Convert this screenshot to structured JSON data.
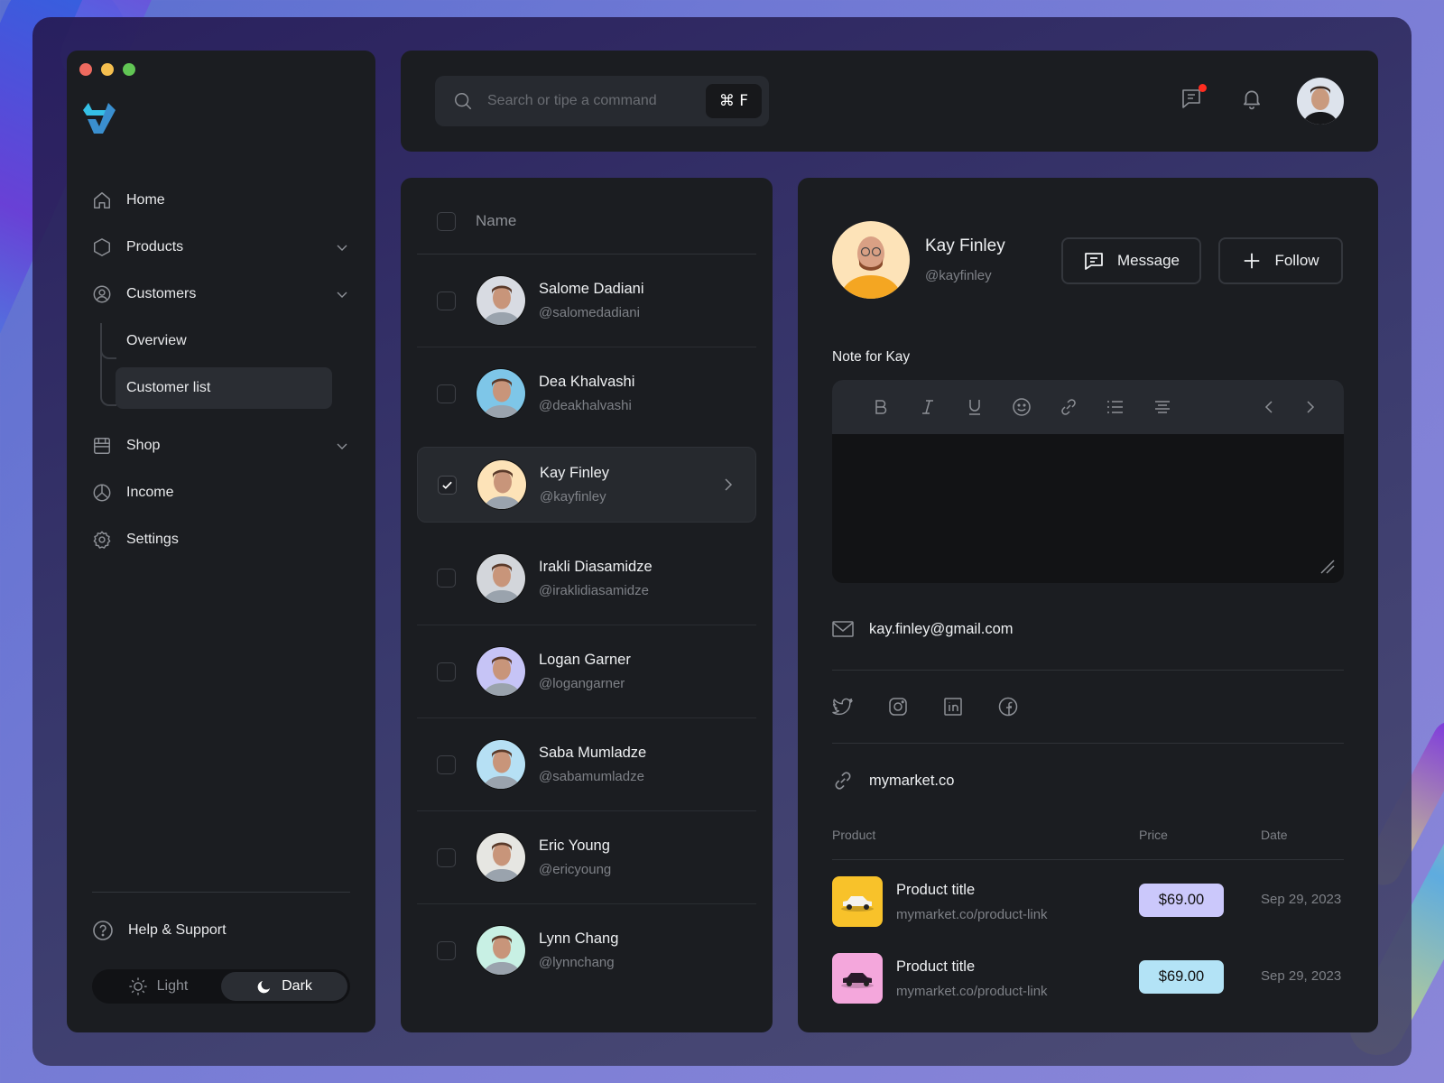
{
  "window": {
    "traffic_lights": [
      "close",
      "minimize",
      "maximize"
    ]
  },
  "sidebar": {
    "logo": "app-logo",
    "items": [
      {
        "label": "Home",
        "icon": "home-icon",
        "has_chevron": false
      },
      {
        "label": "Products",
        "icon": "hexagon-icon",
        "has_chevron": true
      },
      {
        "label": "Customers",
        "icon": "user-circle-icon",
        "has_chevron": true,
        "expanded": true,
        "children": [
          {
            "label": "Overview",
            "active": false
          },
          {
            "label": "Customer list",
            "active": true
          }
        ]
      },
      {
        "label": "Shop",
        "icon": "store-icon",
        "has_chevron": true
      },
      {
        "label": "Income",
        "icon": "pie-chart-icon",
        "has_chevron": false
      },
      {
        "label": "Settings",
        "icon": "gear-icon",
        "has_chevron": false
      }
    ],
    "help_label": "Help & Support",
    "theme": {
      "options": [
        "Light",
        "Dark"
      ],
      "selected": "Dark"
    }
  },
  "topbar": {
    "search": {
      "placeholder": "Search or tipe a command",
      "value": "",
      "shortcut": "⌘ F"
    },
    "icons": [
      "messages-icon",
      "bell-icon"
    ],
    "messages_has_badge": true,
    "badge_color": "#ff2d20"
  },
  "customer_list": {
    "header": "Name",
    "rows": [
      {
        "name": "Salome Dadiani",
        "handle": "@salomedadiani",
        "checked": false,
        "selected": false,
        "avatar_bg": "#d8dbe2"
      },
      {
        "name": "Dea Khalvashi",
        "handle": "@deakhalvashi",
        "checked": false,
        "selected": false,
        "avatar_bg": "#7ec6e8"
      },
      {
        "name": "Kay Finley",
        "handle": "@kayfinley",
        "checked": true,
        "selected": true,
        "avatar_bg": "#fde3b8"
      },
      {
        "name": "Irakli Diasamidze",
        "handle": "@iraklidiasamidze",
        "checked": false,
        "selected": false,
        "avatar_bg": "#d3d6db"
      },
      {
        "name": "Logan Garner",
        "handle": "@logangarner",
        "checked": false,
        "selected": false,
        "avatar_bg": "#c6c4f6"
      },
      {
        "name": "Saba Mumladze",
        "handle": "@sabamumladze",
        "checked": false,
        "selected": false,
        "avatar_bg": "#b6e0f4"
      },
      {
        "name": "Eric Young",
        "handle": "@ericyoung",
        "checked": false,
        "selected": false,
        "avatar_bg": "#e6e6e2"
      },
      {
        "name": "Lynn Chang",
        "handle": "@lynnchang",
        "checked": false,
        "selected": false,
        "avatar_bg": "#c8f0e4"
      }
    ]
  },
  "detail": {
    "name": "Kay Finley",
    "handle": "@kayfinley",
    "message_label": "Message",
    "follow_label": "Follow",
    "note_label": "Note for Kay",
    "note_value": "",
    "toolbar": [
      "bold",
      "italic",
      "underline",
      "emoji",
      "link",
      "bullet-list",
      "align-center",
      "undo",
      "redo"
    ],
    "email": "kay.finley@gmail.com",
    "socials": [
      "twitter",
      "instagram",
      "linkedin",
      "facebook"
    ],
    "website": "mymarket.co",
    "table": {
      "headers": {
        "product": "Product",
        "price": "Price",
        "date": "Date"
      },
      "rows": [
        {
          "title": "Product title",
          "link": "mymarket.co/product-link",
          "price": "$69.00",
          "date": "Sep 29, 2023",
          "price_color": "#cbc8fb",
          "thumb_color": "#f8c22a"
        },
        {
          "title": "Product title",
          "link": "mymarket.co/product-link",
          "price": "$69.00",
          "date": "Sep 29, 2023",
          "price_color": "#b3e3f6",
          "thumb_color": "#f4a7dc"
        }
      ]
    }
  },
  "colors": {
    "panel_bg": "#1b1d21",
    "accent_logo": "#2fb6e4"
  }
}
